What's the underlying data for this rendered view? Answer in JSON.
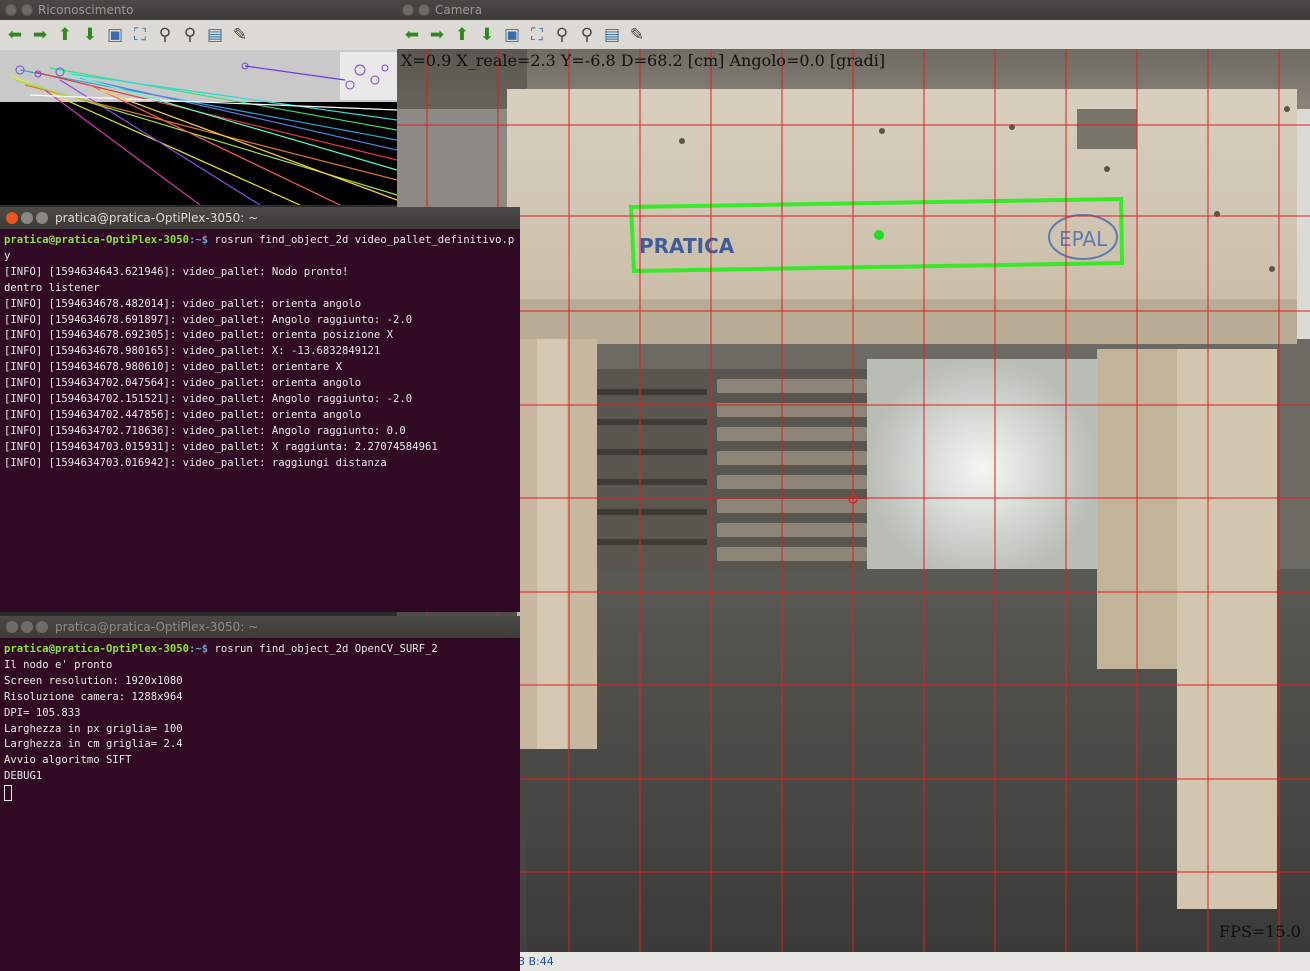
{
  "reco_window": {
    "title": "Riconoscimento"
  },
  "camera_window": {
    "title": "Camera",
    "overlay": "X=0.9 X_reale=2.3 Y=-6.8 D=68.2 [cm] Angolo=0.0 [gradi]",
    "fps": "FPS=15.0",
    "status": "3 B:44",
    "box_labels": {
      "left": "PRATICA",
      "right": "EPAL"
    }
  },
  "toolbar_icons": [
    "arrow-left-icon",
    "arrow-right-icon",
    "arrow-up-icon",
    "arrow-down-icon",
    "image-icon",
    "fit-icon",
    "zoom-in-icon",
    "zoom-out-icon",
    "save-icon",
    "brush-icon"
  ],
  "terminal1": {
    "title": "pratica@pratica-OptiPlex-3050: ~",
    "prompt_user": "pratica@pratica-OptiPlex-3050",
    "prompt_path": ":~$",
    "command": " rosrun find_object_2d video_pallet_definitivo.p",
    "command_wrap": "y",
    "lines": [
      "[INFO] [1594634643.621946]: video_pallet: Nodo pronto!",
      "dentro listener",
      "[INFO] [1594634678.482014]: video_pallet: orienta angolo",
      "[INFO] [1594634678.691897]: video_pallet: Angolo raggiunto: -2.0",
      "[INFO] [1594634678.692305]: video_pallet: orienta posizione X",
      "[INFO] [1594634678.980165]: video_pallet: X: -13.6832849121",
      "[INFO] [1594634678.980610]: video_pallet: orientare X",
      "[INFO] [1594634702.047564]: video_pallet: orienta angolo",
      "[INFO] [1594634702.151521]: video_pallet: Angolo raggiunto: -2.0",
      "[INFO] [1594634702.447856]: video_pallet: orienta angolo",
      "[INFO] [1594634702.718636]: video_pallet: Angolo raggiunto: 0.0",
      "[INFO] [1594634703.015931]: video_pallet: X raggiunta: 2.27074584961",
      "[INFO] [1594634703.016942]: video_pallet: raggiungi distanza"
    ]
  },
  "terminal2": {
    "title": "pratica@pratica-OptiPlex-3050: ~",
    "prompt_user": "pratica@pratica-OptiPlex-3050",
    "prompt_path": ":~$",
    "command": " rosrun find_object_2d OpenCV_SURF_2",
    "lines": [
      "Il nodo e' pronto",
      "Screen resolution: 1920x1080",
      "Risoluzione camera: 1288x964",
      "DPI= 105.833",
      "Larghezza in px griglia= 100",
      "Larghezza in cm griglia= 2.4",
      "Avvio algoritmo SIFT",
      "DEBUG1"
    ]
  }
}
